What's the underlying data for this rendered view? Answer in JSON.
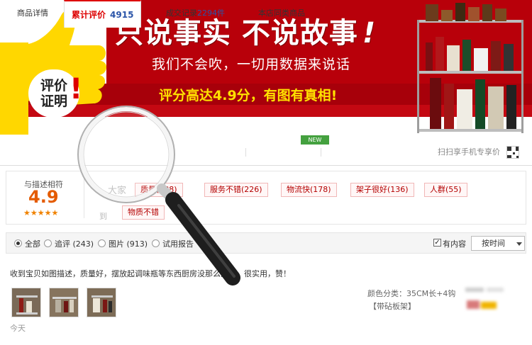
{
  "banner": {
    "headline": "只说事实  不说故事",
    "exclaim": "!",
    "subline": "我们不会吹，一切用数据来说话",
    "highlight": "评分高达4.9分，有图有真相!",
    "badge_line1": "评价",
    "badge_line2": "证明",
    "badge_exclaim": "!"
  },
  "tabs": {
    "items": [
      {
        "label": "商品详情"
      },
      {
        "label": "累计评价",
        "count": "4915"
      },
      {
        "label": "成交记录",
        "count": "2294件"
      },
      {
        "label": "本店同类商品"
      }
    ],
    "new_badge": "NEW",
    "scan_label": "扫扫享手机专享价"
  },
  "rating": {
    "label": "与描述相符",
    "score": "4.9",
    "stars": "★★★★★",
    "side_label": "大家",
    "side_sub": "到",
    "tags": [
      "质量(188)",
      "服务不错(226)",
      "物流快(178)",
      "架子很好(136)",
      "人群(55)",
      "物质不错"
    ]
  },
  "filter": {
    "options": [
      {
        "label": "全部",
        "selected": true
      },
      {
        "label": "追评 (243)",
        "selected": false
      },
      {
        "label": "图片 (913)",
        "selected": false
      },
      {
        "label": "试用报告",
        "selected": false
      }
    ],
    "has_content_label": "有内容",
    "has_content_checked": true,
    "sort_label": "按时间"
  },
  "review": {
    "text": "收到宝贝如图描述，质量好，摆放起调味瓶等东西厨房没那么乱了，很实用，赞！",
    "sku_label": "颜色分类：35CM长+4钩",
    "sku_extra": "【带砧板架】",
    "date": "今天"
  },
  "colors": {
    "brand_red": "#c40812",
    "accent_yellow": "#ffe100",
    "tab_red": "#dd0000",
    "link_blue": "#2a54a8",
    "score_orange": "#e45b00"
  }
}
